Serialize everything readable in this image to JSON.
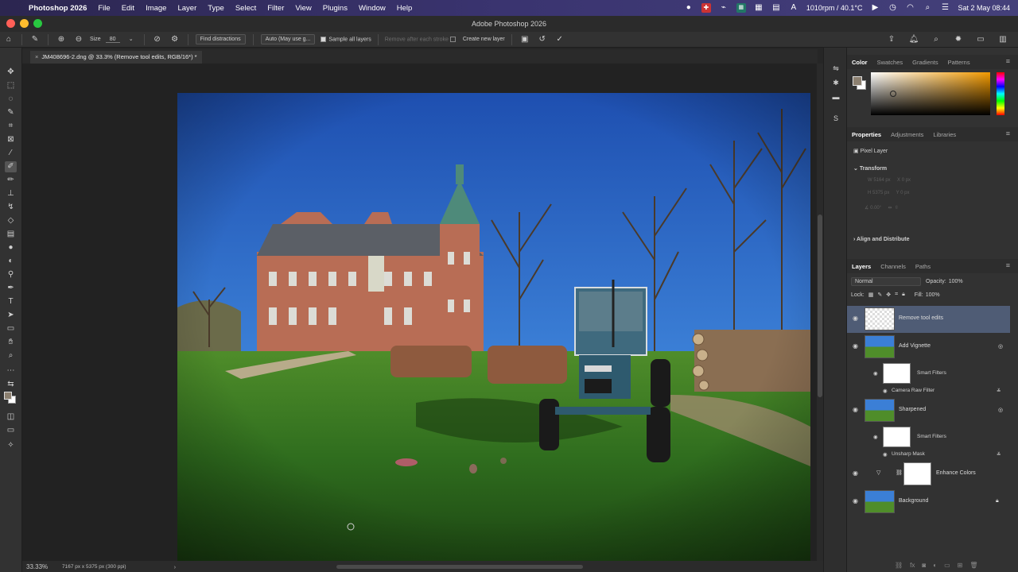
{
  "menubar": {
    "app_name": "Photoshop 2026",
    "items": [
      "File",
      "Edit",
      "Image",
      "Layer",
      "Type",
      "Select",
      "Filter",
      "View",
      "Plugins",
      "Window",
      "Help"
    ],
    "status_rpm": "1010rpm / 40.1°C",
    "datetime": "Sat 2 May  08:44"
  },
  "titlebar": {
    "title": "Adobe Photoshop 2026"
  },
  "options": {
    "size_label": "Size",
    "size_value": "80",
    "find_distractions": "Find distractions",
    "mode_dropdown": "Auto (May use g...",
    "sample_all_layers": "Sample all layers",
    "remove_after_stroke": "Remove after each stroke",
    "create_new_layer": "Create new layer"
  },
  "document": {
    "tab_title": "JM408696-2.dng @ 33.3% (Remove tool edits, RGB/16*) *",
    "zoom": "33.33%",
    "dimensions": "7167 px x 5375 px (300 ppi)"
  },
  "panels": {
    "color_tabs": [
      "Color",
      "Swatches",
      "Gradients",
      "Patterns"
    ],
    "properties_tabs": [
      "Properties",
      "Adjustments",
      "Libraries"
    ],
    "pixel_layer": "Pixel Layer",
    "transform_heading": "Transform",
    "transform": {
      "w": "W  5164 px",
      "h": "H  5375 px",
      "x": "X  0 px",
      "y": "Y  0 px",
      "angle": "0.00°"
    },
    "align_heading": "Align and Distribute",
    "layers_tabs": [
      "Layers",
      "Channels",
      "Paths"
    ],
    "blend_mode": "Normal",
    "opacity_label": "Opacity:",
    "opacity_value": "100%",
    "lock_label": "Lock:",
    "fill_label": "Fill:",
    "fill_value": "100%",
    "layers": {
      "remove": "Remove tool edits",
      "vignette": "Add Vignette",
      "smart_filters_1": "Smart Filters",
      "camera_raw": "Camera Raw Filter",
      "sharpened": "Sharpened",
      "smart_filters_2": "Smart Filters",
      "unsharp": "Unsharp Mask",
      "enhance": "Enhance Colors",
      "background": "Background"
    }
  },
  "colors": {
    "accent_selected_layer": "#4f5c75",
    "fg_swatch": "#8c8070"
  }
}
